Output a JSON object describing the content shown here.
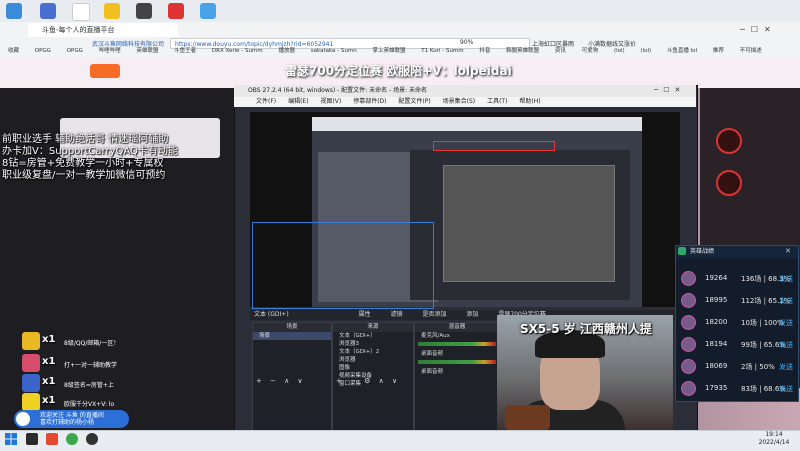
{
  "browser": {
    "tab_title": "斗鱼-每个人的直播平台",
    "url_prefix": "武汉斗鱼网络科技有限公司",
    "url": "https://www.douyu.com/topic/dyhmjzh?rid=6052941",
    "weather": "上海虹口区暴雨",
    "notice": "小满数据线又涨价",
    "zoom": "90%",
    "bookmarks": [
      "收藏",
      "OPGG",
      "OPGG",
      "哔哩哔哩",
      "英雄联盟",
      "斗鱼王者",
      "DRX Xerie - Summ",
      "播放器",
      "sakataka - Sumn",
      "掌上英雄联盟",
      "T1 Kuri - Summ",
      "抖音",
      "韩服英雄联盟",
      "资讯",
      "可爱狗",
      "(lol)",
      "(lol)",
      "斗鱼直播 lol",
      "推荐",
      "不可描述"
    ]
  },
  "stream": {
    "title": "雷瑟700分定位赛 欧服陪+V：lolpeidai",
    "overlay_lines": [
      "前职业选手 辅助绝活哥 情迷瑶阿辅助",
      "办卡加V：SupportCarryQAQ卡有动能",
      "8钻=房管+免费教学一小时+专属权",
      "职业级复盘/一对一教学加微信可预约"
    ],
    "gifts": [
      {
        "count": "x1",
        "text": "8级/QQ/邮箱/一区！"
      },
      {
        "count": "x1",
        "text": "打+一对一辅助教学"
      },
      {
        "count": "x1",
        "text": "8级签名=房管+上"
      },
      {
        "count": "x1",
        "text": "欧服千分VX+V: lo"
      }
    ],
    "chat_tip_line1": "欢迎关注 斗鱼 的直播间",
    "chat_tip_line2": "喜欢打辅助的杨小杨"
  },
  "obs": {
    "title": "OBS 27.2.4 (64 bit, windows) - 配置文件: 未命名 - 场景: 未命名",
    "menu": [
      "文件(F)",
      "编辑(E)",
      "视图(V)",
      "停靠部件(D)",
      "配置文件(P)",
      "场景集合(S)",
      "工具(T)",
      "帮助(H)"
    ],
    "bottombar": [
      "文本 (GDI+)",
      "属性",
      "滤镜",
      "是否添加",
      "添加",
      "雷瑟700分定位赛"
    ],
    "scenes_title": "场景",
    "sources_title": "来源",
    "mixer_title": "混音器",
    "transitions_title": "场景转场",
    "scene_items": [
      "场景"
    ],
    "source_items": [
      "文本（GDI+）",
      "浏览器3",
      "文本（GDI+）2",
      "浏览器",
      "图像",
      "视频采集设备",
      "窗口采集"
    ],
    "mixer_items": [
      "麦克风/Aux",
      "桌面音频",
      "桌面音频"
    ],
    "transition_items": [
      "淡入淡出",
      "时长 300 ms"
    ]
  },
  "cam": {
    "caption": "SX5-5 岁 江西赣州人提"
  },
  "ranking": {
    "title": "英雄战绩",
    "link_label": "发送",
    "rows": [
      {
        "score": "19264",
        "stat": "136场 | 68.3%"
      },
      {
        "score": "18995",
        "stat": "112场 | 65.1%"
      },
      {
        "score": "18200",
        "stat": "10场 | 100%"
      },
      {
        "score": "18194",
        "stat": "99场 | 65.6%"
      },
      {
        "score": "18069",
        "stat": "2场 | 50%"
      },
      {
        "score": "17935",
        "stat": "83场 | 68.6%"
      }
    ]
  },
  "taskbar": {
    "time": "19:14",
    "date": "2022/4/14"
  }
}
